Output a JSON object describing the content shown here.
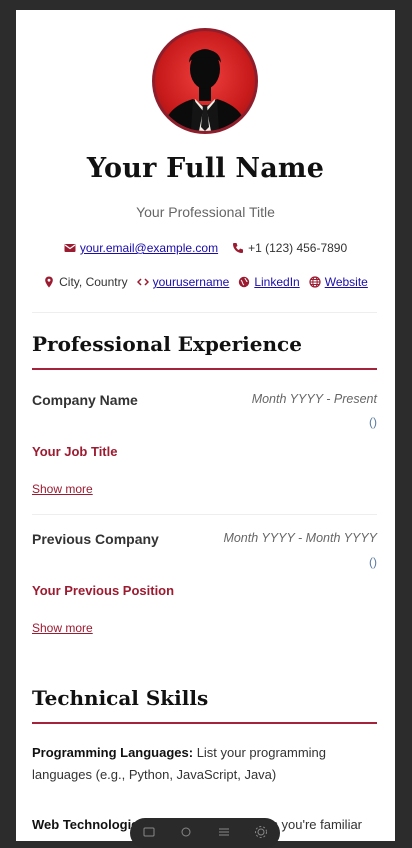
{
  "header": {
    "name": "Your Full Name",
    "title": "Your Professional Title",
    "avatar_icon": "person-silhouette-icon"
  },
  "contact": {
    "email": " your.email@example.com",
    "phone": "+1 (123) 456-7890",
    "location": "City, Country",
    "github": " yourusername",
    "linkedin": " LinkedIn",
    "website": " Website"
  },
  "experience": {
    "heading": "Professional Experience",
    "jobs": [
      {
        "company": "Company Name",
        "dates": "Month YYYY - Present",
        "location": "()",
        "role": "Your Job Title",
        "show_more": "Show more"
      },
      {
        "company": "Previous Company",
        "dates": "Month YYYY - Month YYYY",
        "location": "()",
        "role": "Your Previous Position",
        "show_more": "Show more"
      }
    ]
  },
  "skills": {
    "heading": "Technical Skills",
    "items": [
      {
        "label": "Programming Languages:",
        "text": " List your programming languages (e.g., Python, JavaScript, Java)"
      },
      {
        "label": "Web Technologies:",
        "text": " List web technologies you're familiar"
      }
    ]
  },
  "colors": {
    "accent": "#a3233a",
    "link": "#1a0dab",
    "page_bg": "#ffffff",
    "frame_bg": "#2c2c2c"
  }
}
